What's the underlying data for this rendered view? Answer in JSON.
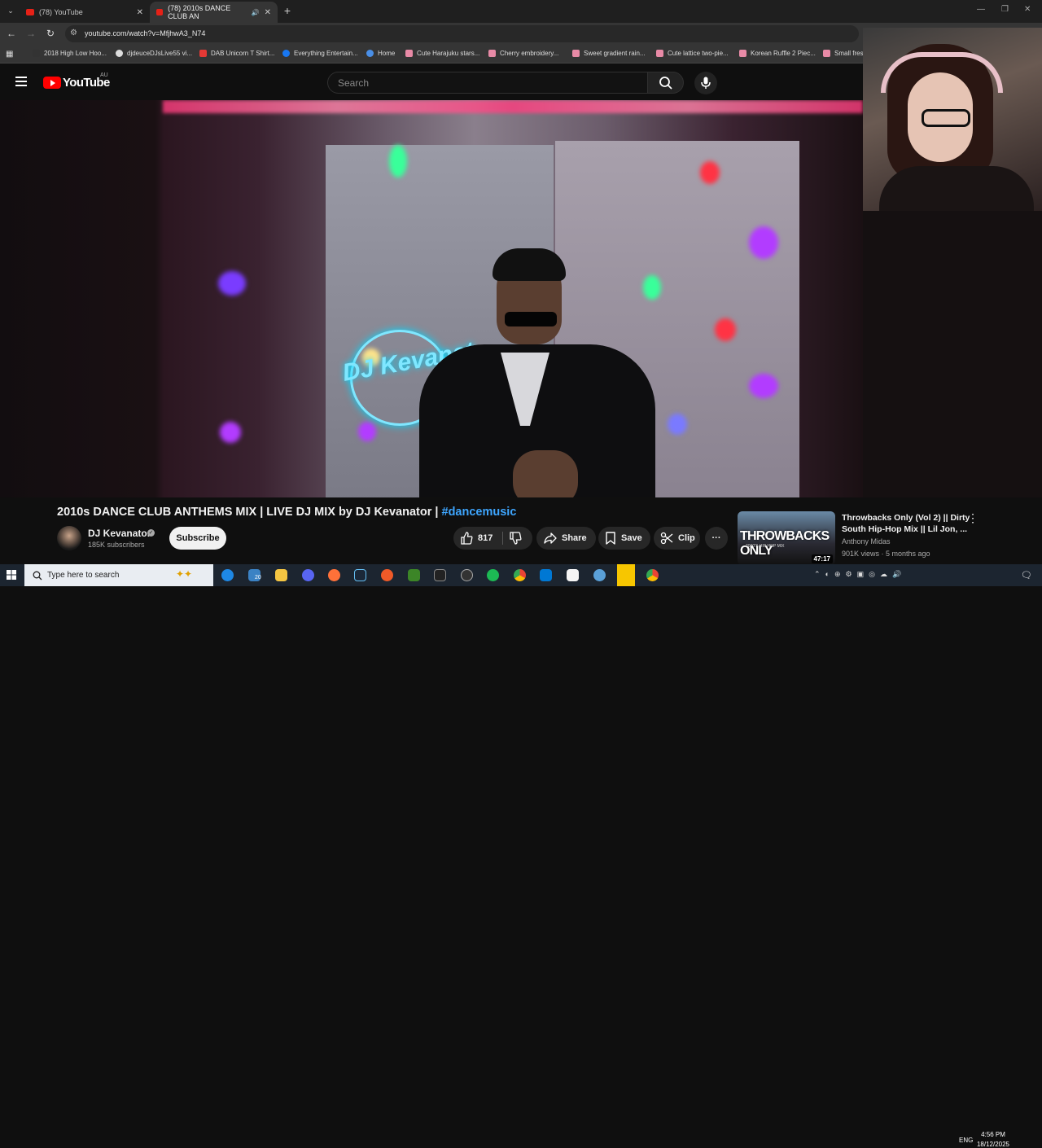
{
  "browser": {
    "tabs": [
      {
        "label": "(78) YouTube",
        "active": false
      },
      {
        "label": "(78) 2010s DANCE CLUB AN",
        "active": true
      }
    ],
    "url": "youtube.com/watch?v=MfjhwA3_N74",
    "bookmarks": [
      "2018 High Low Hoo...",
      "djdeuceDJsLive55 vi...",
      "DAB Unicorn T Shirt...",
      "Everything Entertain...",
      "Home",
      "Cute Harajuku stars...",
      "Cherry embroidery...",
      "Sweet gradient rain...",
      "Cute lattice two-pie...",
      "Korean Ruffle 2 Piec...",
      "Small fres"
    ]
  },
  "youtube": {
    "logo_text": "YouTube",
    "country": "AU",
    "search_placeholder": "Search"
  },
  "video": {
    "sign_text": "DJ Kevanat",
    "title": "2010s DANCE CLUB ANTHEMS MIX | LIVE DJ MIX by DJ Kevanator |",
    "hashtag": "#dancemusic",
    "channel_name": "DJ Kevanator",
    "subscribers": "185K subscribers",
    "subscribe_label": "Subscribe",
    "likes": "817",
    "share_label": "Share",
    "save_label": "Save",
    "clip_label": "Clip",
    "more_label": "···"
  },
  "related": {
    "thumb_text": "THROWBACKS ONLY",
    "thumb_subtext": "2000'S HIP HOP MIX",
    "duration": "47:17",
    "title": "Throwbacks Only (Vol 2) || Dirty South Hip-Hop Mix || Lil Jon, ...",
    "channel": "Anthony Midas",
    "meta": "901K views · 5 months ago"
  },
  "taskbar": {
    "search_placeholder": "Type here to search",
    "lang": "ENG",
    "time": "4:56 PM",
    "date": "18/12/2025",
    "badge": "20"
  },
  "colors": {
    "accent_red": "#ff0000",
    "hashtag_blue": "#3ea6ff",
    "neon_cyan": "#7fe7ff"
  }
}
